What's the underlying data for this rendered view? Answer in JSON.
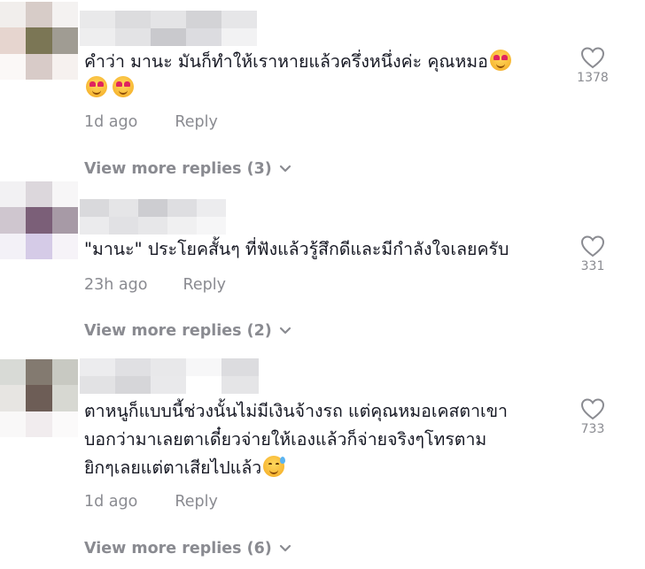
{
  "comments": [
    {
      "text_line1": "คำว่า มานะ มันก็ทำให้เราหายแล้วครึ่งหนึ่งค่ะ คุณหมอ",
      "text_line2": "",
      "text_line3": "",
      "emojis": [
        "smiling-face-with-heart-eyes",
        "smiling-face-with-heart-eyes",
        "smiling-face-with-heart-eyes"
      ],
      "time": "1d ago",
      "reply_label": "Reply",
      "view_more": "View more replies (3)",
      "likes": "1378",
      "like_icon": "heart-outline-icon",
      "username_blurred": true,
      "avatar_blurred": true
    },
    {
      "text_line1": "\"มานะ\" ประโยคสั้นๆ ที่ฟังแล้วรู้สึกดีและมีกำลังใจเลยครับ",
      "text_line2": "",
      "text_line3": "",
      "emojis": [],
      "time": "23h ago",
      "reply_label": "Reply",
      "view_more": "View more replies (2)",
      "likes": "331",
      "like_icon": "heart-outline-icon",
      "username_blurred": true,
      "avatar_blurred": true
    },
    {
      "text_line1": "ตาหนูก็แบบนี้ช่วงนั้นไม่มีเงินจ้างรถ แต่คุณหมอเคสตาเขา",
      "text_line2": "บอกว่ามาเลยตาเดี๋ยวจ่ายให้เองแล้วก็จ่ายจริงๆโทรตาม",
      "text_line3": "ยิกๆเลยแต่ตาเสียไปแล้ว",
      "emojis": [
        "smiling-face-with-sweat"
      ],
      "time": "1d ago",
      "reply_label": "Reply",
      "view_more": "View more replies (6)",
      "likes": "733",
      "like_icon": "heart-outline-icon",
      "username_blurred": true,
      "avatar_blurred": true
    }
  ],
  "colors": {
    "text": "#161823",
    "secondary": "#8a8b91",
    "background": "#ffffff"
  }
}
